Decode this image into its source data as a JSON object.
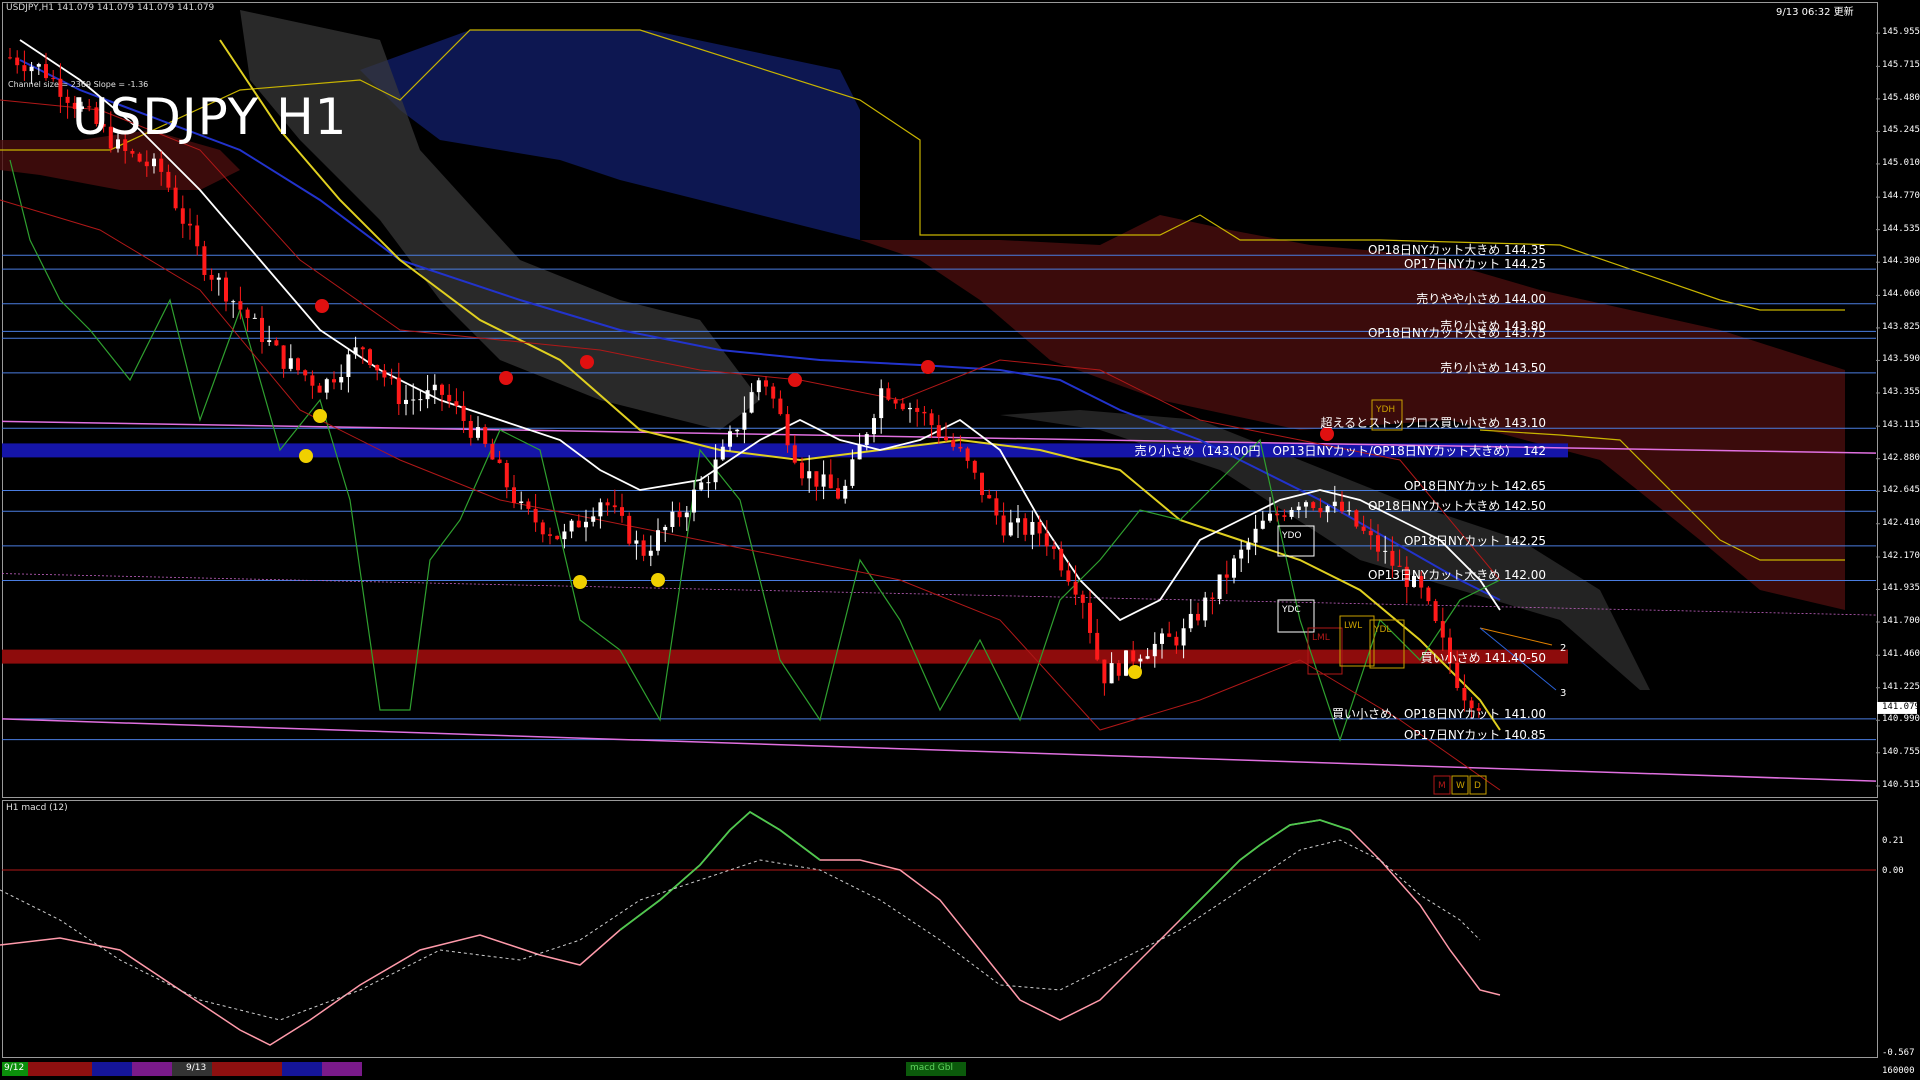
{
  "window": {
    "title_bar": "USDJPY,H1  141.079 141.079 141.079 141.079",
    "timestamp": "9/13 06:32 更新",
    "channel_info": "Channel size = 2369 Slope = -1.36",
    "chart_title": "USDJPY H1"
  },
  "indicator": {
    "label": "H1  macd (12)",
    "axis_top": "0.21",
    "axis_zero": "0.00",
    "axis_bottom": "-0.567",
    "axis_floor": "160000"
  },
  "price_axis": {
    "labels": [
      "145.955",
      "145.715",
      "145.480",
      "145.245",
      "145.010",
      "144.770",
      "144.535",
      "144.300",
      "144.060",
      "143.825",
      "143.590",
      "143.355",
      "143.115",
      "142.880",
      "142.645",
      "142.410",
      "142.170",
      "141.935",
      "141.700",
      "141.460",
      "141.225",
      "140.990",
      "140.755",
      "140.515"
    ],
    "current": "141.079",
    "ymax": 146.05,
    "ymin": 140.45
  },
  "levels": [
    {
      "price": 144.35,
      "text": "OP18日NYカット大きめ 144.35",
      "color": "#4a7de0"
    },
    {
      "price": 144.25,
      "text": "OP17日NYカット 144.25",
      "color": "#4a7de0"
    },
    {
      "price": 144.0,
      "text": "売りやや小さめ 144.00",
      "color": "#4a7de0"
    },
    {
      "price": 143.8,
      "text": "売り小さめ 143.80",
      "color": "#4a7de0"
    },
    {
      "price": 143.75,
      "text": "OP18日NYカット大きめ 143.75",
      "color": "#4a7de0"
    },
    {
      "price": 143.5,
      "text": "売り小さめ 143.50",
      "color": "#4a7de0"
    },
    {
      "price": 143.1,
      "text": "超えるとストップロス買い小さめ 143.10",
      "color": "#4a7de0"
    },
    {
      "price": 142.65,
      "text": "OP18日NYカット 142.65",
      "color": "#4a7de0"
    },
    {
      "price": 142.5,
      "text": "OP18日NYカット大きめ 142.50",
      "color": "#4a7de0"
    },
    {
      "price": 142.25,
      "text": "OP18日NYカット 142.25",
      "color": "#4a7de0"
    },
    {
      "price": 142.0,
      "text": "OP13日NYカット大きめ 142.00",
      "color": "#4a7de0"
    },
    {
      "price": 141.0,
      "text": "買い小さめ、OP18日NYカット 141.00",
      "color": "#4a7de0"
    },
    {
      "price": 140.85,
      "text": "OP17日NYカット 140.85",
      "color": "#4a7de0"
    }
  ],
  "bands": [
    {
      "price": 142.94,
      "text": "売り小さめ（143.00円　OP13日NYカット/OP18日NYカット大きめ）　142",
      "color": "#1515a8"
    },
    {
      "price": 141.45,
      "text": "買い小さめ 141.40-50",
      "color": "#8e0c0c"
    }
  ],
  "box_labels": [
    "YDH",
    "YDO",
    "YDC",
    "YDL",
    "LML",
    "LWL",
    "M",
    "W",
    "D"
  ],
  "projection_labels": [
    "2",
    "3"
  ],
  "bottom_tabs": {
    "date1": "9/12",
    "date2": "9/13",
    "status": "macd Gbl"
  }
}
